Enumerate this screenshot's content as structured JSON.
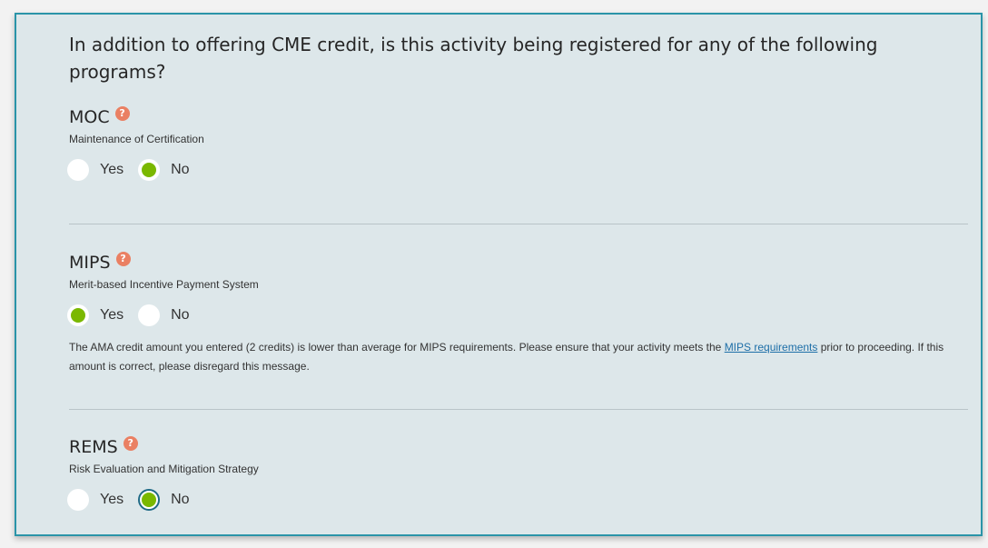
{
  "question": "In addition to offering CME credit, is this activity being registered for any of the following programs?",
  "colors": {
    "panel_bg": "#dde7ea",
    "panel_border": "#2a94a8",
    "help_icon": "#ea8063",
    "radio_selected": "#7ab800",
    "link": "#1e6fa8"
  },
  "help_icon": {
    "glyph": "?",
    "icon": "question-mark-icon"
  },
  "moc": {
    "title": "MOC",
    "subtitle": "Maintenance of Certification",
    "yes_label": "Yes",
    "no_label": "No",
    "selected": "No"
  },
  "mips": {
    "title": "MIPS",
    "subtitle": "Merit-based Incentive Payment System",
    "yes_label": "Yes",
    "no_label": "No",
    "selected": "Yes",
    "notice_before": "The AMA credit amount you entered (2 credits) is lower than average for MIPS requirements. Please ensure that your activity meets the ",
    "notice_link": "MIPS requirements",
    "notice_after": " prior to proceeding. If this amount is correct, please disregard this message."
  },
  "rems": {
    "title": "REMS",
    "subtitle": "Risk Evaluation and Mitigation Strategy",
    "yes_label": "Yes",
    "no_label": "No",
    "selected": "No"
  }
}
